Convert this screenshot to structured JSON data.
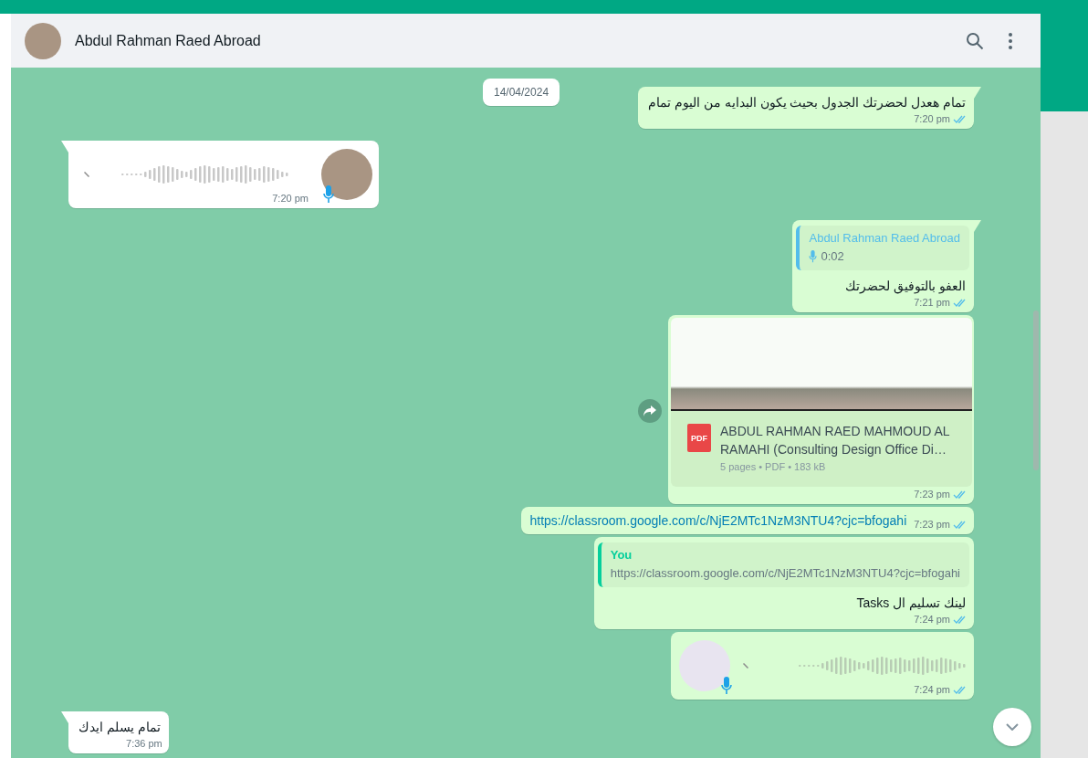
{
  "header": {
    "contact_name": "Abdul Rahman Raed Abroad"
  },
  "date_chip": "14/04/2024",
  "messages": [
    {
      "kind": "text",
      "outgoing": true,
      "text": "تمام هعدل لحضرتك الجدول بحيث يكون البدايه من اليوم تمام",
      "time": "7:20 pm",
      "read": true
    },
    {
      "kind": "voice",
      "outgoing": false,
      "time": "7:20 pm"
    },
    {
      "kind": "reply",
      "outgoing": true,
      "quote": {
        "kind": "voice",
        "author": "Abdul Rahman Raed Abroad",
        "text": "0:02"
      },
      "text": "العفو بالتوفيق لحضرتك",
      "time": "7:21 pm",
      "read": true
    },
    {
      "kind": "document",
      "outgoing": true,
      "file_name": "ABDUL RAHMAN RAED MAHMOUD AL RAMAHI (Consulting Design Office Di…",
      "file_meta": "5 pages • PDF • 183 kB",
      "file_type": "PDF",
      "time": "7:23 pm",
      "read": true
    },
    {
      "kind": "link",
      "outgoing": true,
      "text": "https://classroom.google.com/c/NjE2MTc1NzM3NTU4?cjc=bfogahi",
      "time": "7:23 pm",
      "read": true
    },
    {
      "kind": "reply",
      "outgoing": true,
      "quote": {
        "kind": "text",
        "author": "You",
        "text": "https://classroom.google.com/c/NjE2MTc1NzM3NTU4?cjc=bfogahi"
      },
      "text": "لينك تسليم ال Tasks",
      "time": "7:24 pm",
      "read": true
    },
    {
      "kind": "voice",
      "outgoing": true,
      "time": "7:24 pm",
      "read": true
    },
    {
      "kind": "text",
      "outgoing": false,
      "text": "تمام يسلم ايدك",
      "time": "7:36 pm"
    }
  ]
}
